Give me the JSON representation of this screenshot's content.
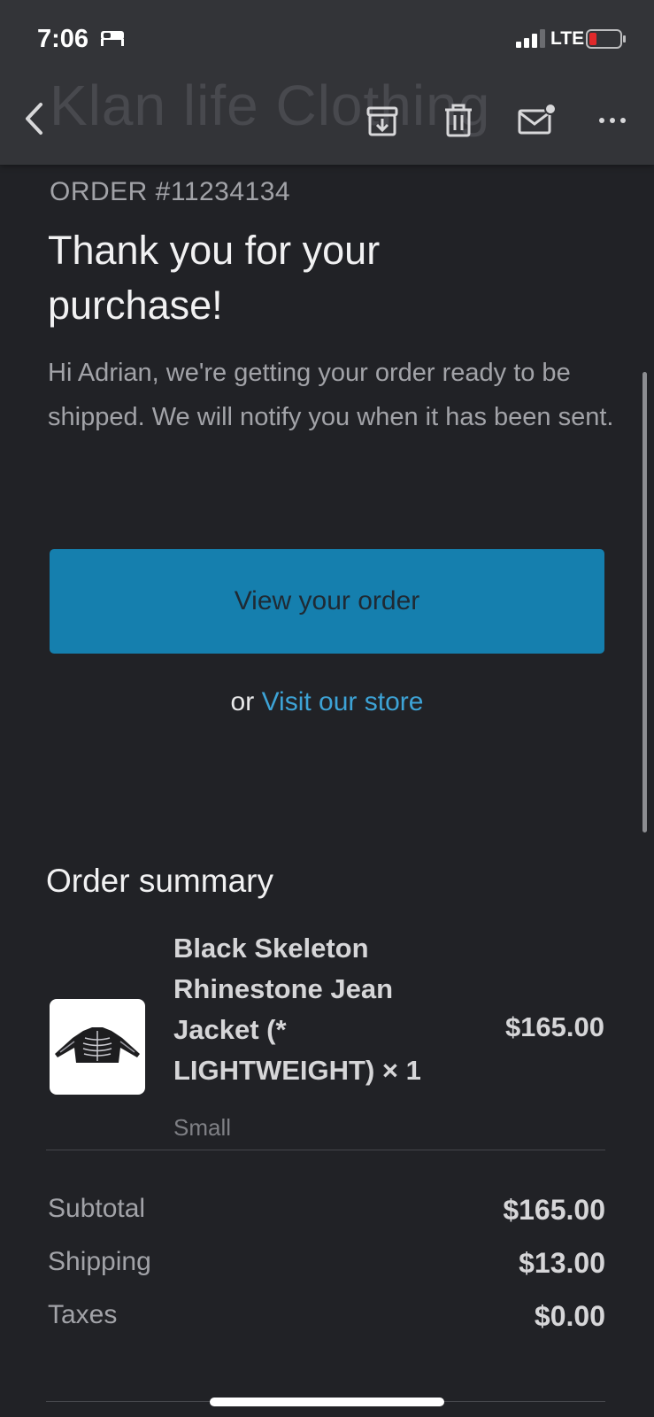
{
  "status_bar": {
    "time": "7:06",
    "network": "LTE",
    "battery_color": "#e0292b"
  },
  "header": {
    "brand": "Klan life Clothing",
    "icons": [
      "back-icon",
      "archive-icon",
      "trash-icon",
      "mail-unread-icon",
      "more-icon"
    ]
  },
  "email": {
    "order_number": "ORDER #11234134",
    "headline": "Thank you for your purchase!",
    "intro": "Hi Adrian, we're getting your order ready to be shipped. We will notify you when it has been sent.",
    "cta_label": "View your order",
    "or_text": "or",
    "store_link": "Visit our store"
  },
  "summary": {
    "title": "Order summary",
    "items": [
      {
        "name": "Black Skeleton Rhinestone Jean Jacket (* LIGHTWEIGHT) × 1",
        "variant": "Small",
        "price": "$165.00",
        "thumbnail": "black-skeleton-jacket-image"
      }
    ],
    "totals": [
      {
        "label": "Subtotal",
        "value": "$165.00"
      },
      {
        "label": "Shipping",
        "value": "$13.00"
      },
      {
        "label": "Taxes",
        "value": "$0.00"
      }
    ]
  },
  "colors": {
    "background": "#212226",
    "toolbar": "#333438",
    "cta": "#157fae",
    "link": "#3da3d6"
  }
}
